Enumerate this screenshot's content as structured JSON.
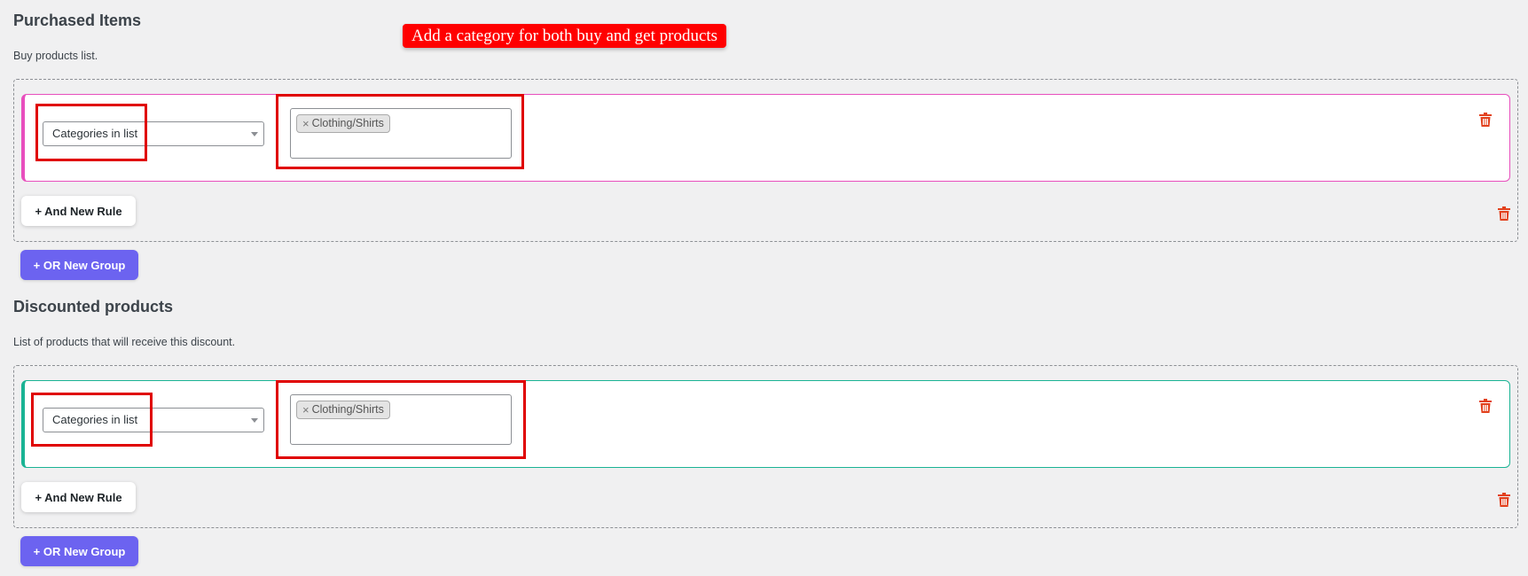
{
  "annotation": {
    "callout_text": "Add a category for both buy and get products"
  },
  "purchased": {
    "title": "Purchased Items",
    "description": "Buy products list.",
    "rule": {
      "condition": "Categories in list",
      "chips": [
        "Clothing/Shirts"
      ]
    },
    "and_rule_label": "+ And New Rule",
    "or_group_label": "+ OR New Group"
  },
  "discounted": {
    "title": "Discounted products",
    "description": "List of products that will receive this discount.",
    "rule": {
      "condition": "Categories in list",
      "chips": [
        "Clothing/Shirts"
      ]
    },
    "and_rule_label": "+ And New Rule",
    "or_group_label": "+ OR New Group"
  },
  "colors": {
    "accent_purple": "#6c63f0",
    "buy_rule_border": "#e84fbd",
    "get_rule_border": "#1ab394",
    "delete_icon": "#e2401c",
    "annotation_red": "#e00000"
  },
  "icons": {
    "remove_chip": "×",
    "delete": "trash-icon",
    "dropdown": "chevron-down-icon"
  }
}
